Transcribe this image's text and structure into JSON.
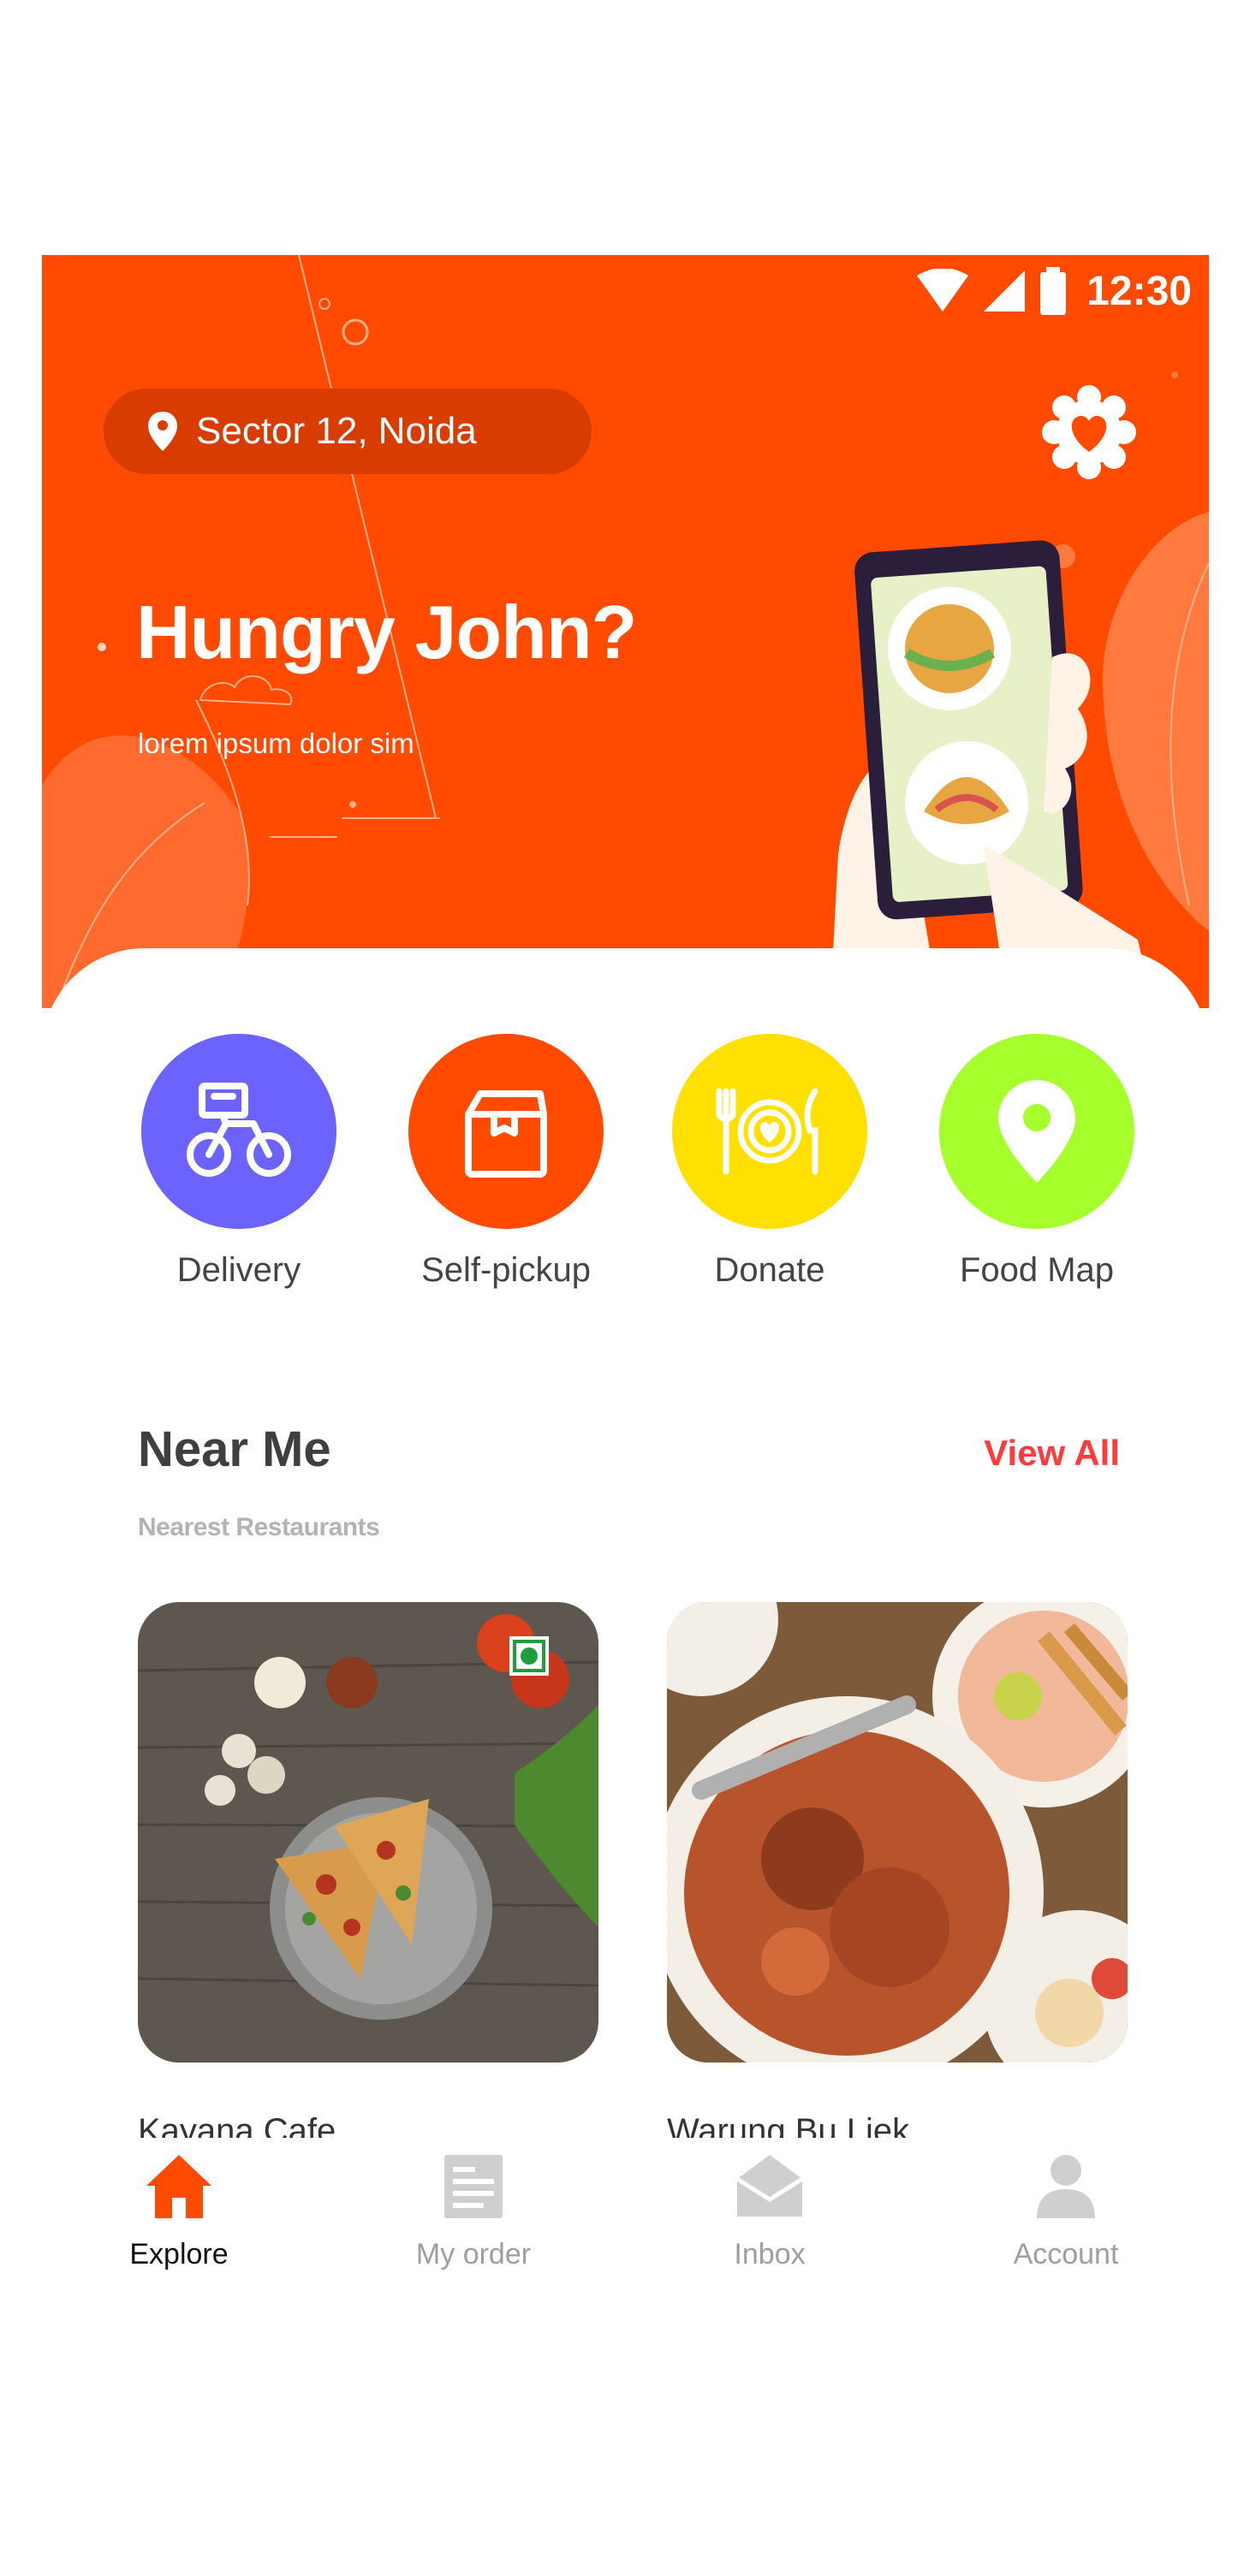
{
  "status_bar": {
    "time": "12:30"
  },
  "header": {
    "location": "Sector 12, Noida",
    "greeting": "Hungry John?",
    "subtitle": "lorem ipsum dolor sim"
  },
  "categories": [
    {
      "label": "Delivery",
      "color": "#6c63ff",
      "icon": "bicycle-icon"
    },
    {
      "label": "Self-pickup",
      "color": "#ff4a00",
      "icon": "shopping-bag-icon"
    },
    {
      "label": "Donate",
      "color": "#ffe000",
      "icon": "plate-heart-icon"
    },
    {
      "label": "Food Map",
      "color": "#a6ff2b",
      "icon": "map-pin-icon"
    }
  ],
  "near_me": {
    "title": "Near Me",
    "subtitle": "Nearest Restaurants",
    "view_all": "View All",
    "restaurants": [
      {
        "name": "Kayana Cafe"
      },
      {
        "name": "Warung Bu Liek"
      }
    ]
  },
  "bottom_nav": [
    {
      "label": "Explore",
      "icon": "home-icon",
      "active": true
    },
    {
      "label": "My order",
      "icon": "receipt-icon",
      "active": false
    },
    {
      "label": "Inbox",
      "icon": "envelope-icon",
      "active": false
    },
    {
      "label": "Account",
      "icon": "user-icon",
      "active": false
    }
  ],
  "colors": {
    "accent": "#ff4a00",
    "link": "#ff3b3b"
  }
}
